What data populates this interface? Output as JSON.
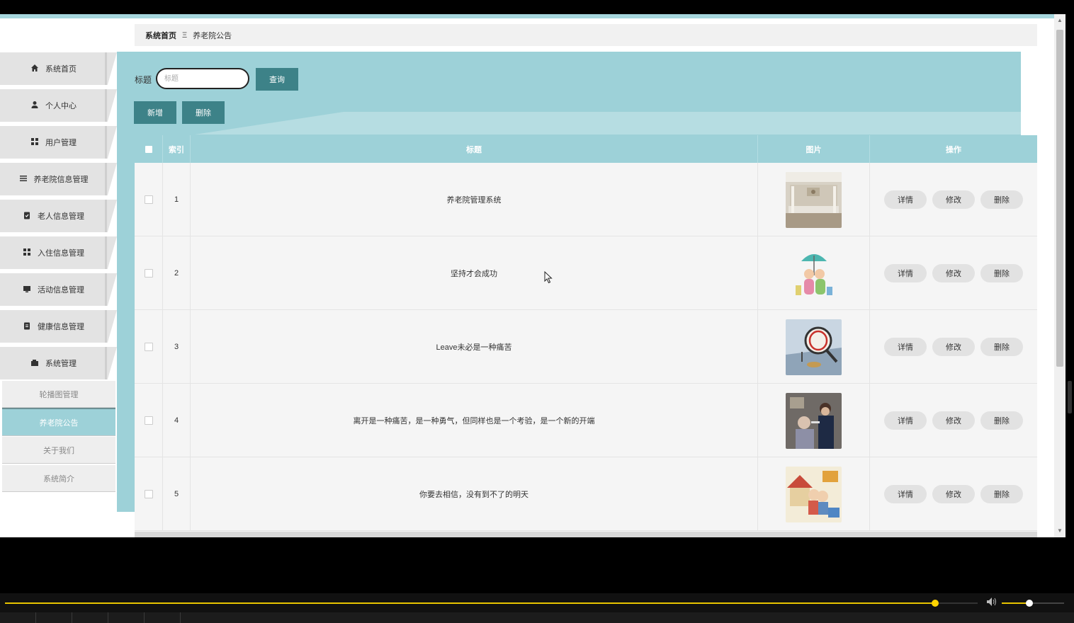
{
  "breadcrumb": {
    "home": "系统首页",
    "separator": "Ξ",
    "current": "养老院公告"
  },
  "sidebar": {
    "items": [
      {
        "label": "系统首页",
        "icon": "home-icon"
      },
      {
        "label": "个人中心",
        "icon": "user-icon"
      },
      {
        "label": "用户管理",
        "icon": "grid-icon"
      },
      {
        "label": "养老院信息管理",
        "icon": "list-icon"
      },
      {
        "label": "老人信息管理",
        "icon": "clipboard-check-icon"
      },
      {
        "label": "入住信息管理",
        "icon": "grid-icon"
      },
      {
        "label": "活动信息管理",
        "icon": "monitor-icon"
      },
      {
        "label": "健康信息管理",
        "icon": "clipboard-icon"
      },
      {
        "label": "系统管理",
        "icon": "settings-folder-icon"
      }
    ],
    "submenu": [
      {
        "label": "轮播图管理",
        "active": false
      },
      {
        "label": "养老院公告",
        "active": true
      },
      {
        "label": "关于我们",
        "active": false
      },
      {
        "label": "系统简介",
        "active": false
      }
    ]
  },
  "search": {
    "label": "标题",
    "placeholder": "标题",
    "value": "",
    "query_button": "查询"
  },
  "actions": {
    "add": "新增",
    "delete": "删除"
  },
  "table": {
    "columns": {
      "index": "索引",
      "title": "标题",
      "image": "图片",
      "ops": "操作"
    },
    "row_actions": {
      "detail": "详情",
      "edit": "修改",
      "delete": "删除"
    },
    "rows": [
      {
        "index": "1",
        "title": "养老院管理系统",
        "image": "lobby-photo"
      },
      {
        "index": "2",
        "title": "坚持才会成功",
        "image": "elderly-couple-umbrella-illustration"
      },
      {
        "index": "3",
        "title": "Leave未必是一种痛苦",
        "image": "pension-magnifier-photo"
      },
      {
        "index": "4",
        "title": "离开是一种痛苦，是一种勇气，但同样也是一个考验，是一个新的开端",
        "image": "caregiver-feeding-photo"
      },
      {
        "index": "5",
        "title": "你要去相信，没有到不了的明天",
        "image": "elderly-care-cartoon"
      }
    ]
  },
  "colors": {
    "teal": "#9dd1d8",
    "teal_dark": "#3d8288",
    "progress": "#e8c400"
  },
  "player": {
    "progress": 0.956,
    "volume": 0.44
  }
}
